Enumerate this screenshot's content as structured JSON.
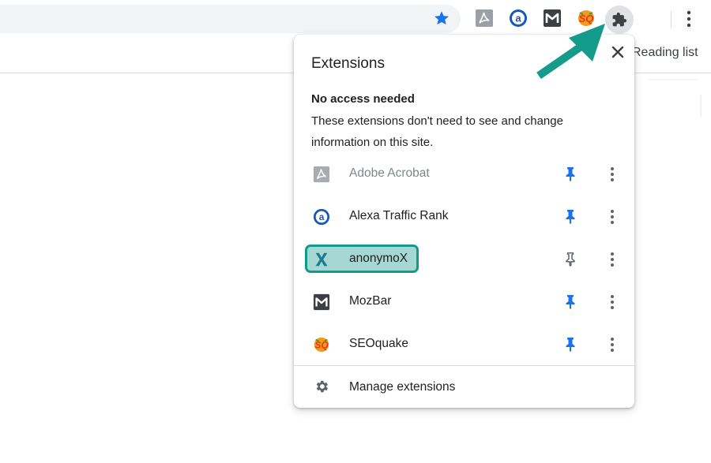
{
  "toolbar": {
    "bookmark_icon": "star-icon",
    "icons": [
      "adobe-acrobat-icon",
      "alexa-icon",
      "mozbar-icon",
      "seoquake-icon",
      "puzzle-icon",
      "kebab-menu-icon"
    ],
    "reading_list_label": "Reading list"
  },
  "popup": {
    "title": "Extensions",
    "section_heading": "No access needed",
    "section_description": "These extensions don't need to see and change information on this site.",
    "extensions": [
      {
        "name": "Adobe Acrobat",
        "icon": "adobe-acrobat-icon",
        "pinned": true,
        "dimmed": true
      },
      {
        "name": "Alexa Traffic Rank",
        "icon": "alexa-icon",
        "pinned": true,
        "dimmed": false
      },
      {
        "name": "anonymoX",
        "icon": "anonymox-icon",
        "pinned": false,
        "dimmed": false,
        "highlighted": true
      },
      {
        "name": "MozBar",
        "icon": "mozbar-icon",
        "pinned": true,
        "dimmed": false
      },
      {
        "name": "SEOquake",
        "icon": "seoquake-icon",
        "pinned": true,
        "dimmed": false
      }
    ],
    "manage_label": "Manage extensions"
  },
  "colors": {
    "pin_blue": "#1a73e8",
    "pin_gray": "#5f6368",
    "highlight_fill": "#a5d8d3",
    "highlight_border": "#139a8c",
    "arrow": "#149b8b"
  }
}
